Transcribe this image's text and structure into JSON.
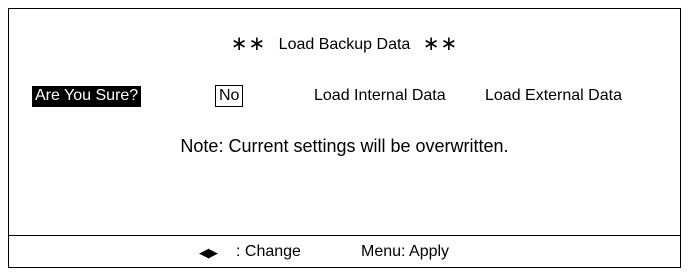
{
  "dialog": {
    "title_prefix": "∗∗",
    "title": "Load Backup Data",
    "title_suffix": "∗∗",
    "question": "Are You Sure?",
    "options": [
      {
        "label": "No",
        "selected": true
      },
      {
        "label": "Load Internal Data",
        "selected": false
      },
      {
        "label": "Load External Data",
        "selected": false
      }
    ],
    "note": "Note: Current settings will be overwritten."
  },
  "footer": {
    "arrows": "◀▶",
    "change_hint": ": Change",
    "apply_hint": "Menu: Apply"
  }
}
